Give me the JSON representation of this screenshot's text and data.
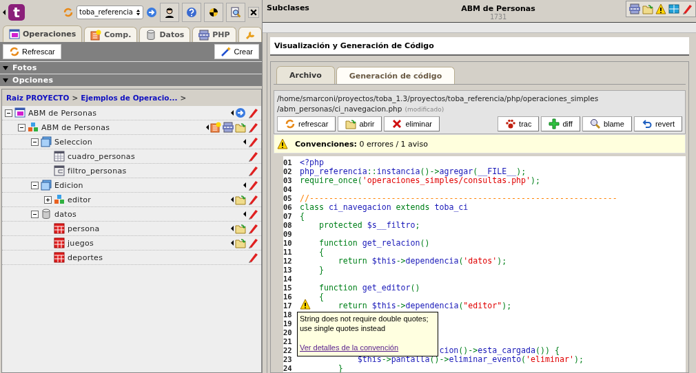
{
  "left": {
    "logo": "t",
    "project": "toba_referencia",
    "tabs": [
      {
        "label": "Operaciones",
        "kind": "op",
        "selected": true
      },
      {
        "label": "Comp.",
        "kind": "comp",
        "selected": false
      },
      {
        "label": "Datos",
        "kind": "db",
        "selected": false
      },
      {
        "label": "PHP",
        "kind": "php",
        "selected": false
      },
      {
        "kind": "wrench",
        "selected": false
      }
    ],
    "toolbar": {
      "refresh": "Refrescar",
      "create": "Crear"
    },
    "sections": [
      {
        "label": "Fotos",
        "expanded": true
      },
      {
        "label": "Opciones",
        "expanded": true
      }
    ],
    "breadcrumb": [
      {
        "label": "Raiz PROYECTO",
        "kind": "link"
      },
      {
        "label": ">",
        "kind": "sep"
      },
      {
        "label": "Ejemplos de Operacio...",
        "kind": "link"
      },
      {
        "label": ">",
        "kind": "sep"
      }
    ],
    "tree": [
      {
        "label": "ABM de Personas",
        "kind": "op",
        "expanded": true,
        "actions": [
          {
            "kind": "menu"
          },
          {
            "kind": "go"
          },
          {
            "kind": "edit"
          }
        ],
        "children": [
          {
            "label": "ABM de Personas",
            "kind": "ci",
            "expanded": true,
            "actions": [
              {
                "kind": "menu"
              },
              {
                "kind": "comp"
              },
              {
                "kind": "php"
              },
              {
                "kind": "folder"
              },
              {
                "kind": "edit"
              }
            ],
            "children": [
              {
                "label": "Seleccion",
                "kind": "screen",
                "expanded": true,
                "actions": [
                  {
                    "kind": "menu"
                  },
                  {
                    "kind": "edit"
                  }
                ],
                "children": [
                  {
                    "label": "cuadro_personas",
                    "kind": "grid",
                    "actions": [
                      {
                        "kind": "edit"
                      }
                    ]
                  },
                  {
                    "label": "filtro_personas",
                    "kind": "form",
                    "actions": [
                      {
                        "kind": "edit"
                      }
                    ]
                  }
                ]
              },
              {
                "label": "Edicion",
                "kind": "screen",
                "expanded": true,
                "actions": [
                  {
                    "kind": "menu"
                  },
                  {
                    "kind": "edit"
                  }
                ],
                "children": [
                  {
                    "label": "editor",
                    "kind": "ci",
                    "expanded": false,
                    "actions": [
                      {
                        "kind": "menu"
                      },
                      {
                        "kind": "folder"
                      },
                      {
                        "kind": "edit"
                      }
                    ]
                  }
                ]
              },
              {
                "label": "datos",
                "kind": "db",
                "expanded": true,
                "actions": [
                  {
                    "kind": "menu"
                  },
                  {
                    "kind": "edit"
                  }
                ],
                "children": [
                  {
                    "label": "persona",
                    "kind": "table",
                    "actions": [
                      {
                        "kind": "menu"
                      },
                      {
                        "kind": "folder"
                      },
                      {
                        "kind": "edit"
                      }
                    ]
                  },
                  {
                    "label": "juegos",
                    "kind": "table",
                    "actions": [
                      {
                        "kind": "menu"
                      },
                      {
                        "kind": "folder2"
                      },
                      {
                        "kind": "edit"
                      }
                    ]
                  },
                  {
                    "label": "deportes",
                    "kind": "table",
                    "actions": [
                      {
                        "kind": "edit"
                      }
                    ]
                  }
                ]
              }
            ]
          }
        ]
      }
    ]
  },
  "right": {
    "header": {
      "title": "Subclases",
      "item": "ABM de Personas",
      "id": "1731",
      "tools": [
        {
          "kind": "php"
        },
        {
          "kind": "folder"
        },
        {
          "kind": "warning"
        },
        {
          "kind": "cubes"
        },
        {
          "kind": "edit"
        }
      ]
    },
    "panel_title": "Visualización y Generación de Código",
    "tabs": [
      {
        "label": "Archivo",
        "selected": true
      },
      {
        "label": "Generación de código",
        "selected": false
      }
    ],
    "file": {
      "path_1": "/home/smarconi/proyectos/toba_1.3/proyectos/toba_referencia/php/operaciones_simples",
      "path_2": "/abm_personas/ci_navegacion.php",
      "status": "(modificado)"
    },
    "buttons_left": [
      {
        "label": "refrescar",
        "kind": "refresh"
      },
      {
        "label": "abrir",
        "kind": "open"
      },
      {
        "label": "eliminar",
        "kind": "delete"
      }
    ],
    "buttons_right": [
      {
        "label": "trac",
        "kind": "paw"
      },
      {
        "label": "diff",
        "kind": "diff"
      },
      {
        "label": "blame",
        "kind": "blame"
      },
      {
        "label": "revert",
        "kind": "revert"
      }
    ],
    "conventions": "**Convenciones:** 0 errores / 1 aviso",
    "code": [
      {
        "n": "01",
        "tokens": [
          {
            "kind": "k",
            "text": "<?php"
          }
        ]
      },
      {
        "n": "02",
        "tokens": [
          {
            "kind": "k",
            "text": "php_referencia"
          },
          {
            "kind": "g",
            "text": "::"
          },
          {
            "kind": "k",
            "text": "instancia"
          },
          {
            "kind": "g",
            "text": "()->"
          },
          {
            "kind": "k",
            "text": "agregar"
          },
          {
            "kind": "g",
            "text": "("
          },
          {
            "kind": "k",
            "text": "__FILE__"
          },
          {
            "kind": "g",
            "text": ");"
          }
        ]
      },
      {
        "n": "03",
        "tokens": [
          {
            "kind": "g",
            "text": "require_once("
          },
          {
            "kind": "s",
            "text": "'operaciones_simples/consultas.php'"
          },
          {
            "kind": "g",
            "text": ");"
          }
        ]
      },
      {
        "n": "04"
      },
      {
        "n": "05",
        "tokens": [
          {
            "kind": "c",
            "text": "//----------------------------------------------------------------"
          }
        ]
      },
      {
        "n": "06",
        "tokens": [
          {
            "kind": "g",
            "text": "class "
          },
          {
            "kind": "k",
            "text": "ci_navegacion"
          },
          {
            "kind": "g",
            "text": " extends "
          },
          {
            "kind": "k",
            "text": "toba_ci"
          }
        ]
      },
      {
        "n": "07",
        "tokens": [
          {
            "kind": "g",
            "text": "{"
          }
        ]
      },
      {
        "n": "08",
        "tokens": [
          {
            "kind": "g",
            "text": "    protected "
          },
          {
            "kind": "k",
            "text": "$s__filtro"
          },
          {
            "kind": "g",
            "text": ";"
          }
        ]
      },
      {
        "n": "09"
      },
      {
        "n": "10",
        "tokens": [
          {
            "kind": "g",
            "text": "    function "
          },
          {
            "kind": "k",
            "text": "get_relacion"
          },
          {
            "kind": "g",
            "text": "()"
          }
        ]
      },
      {
        "n": "11",
        "tokens": [
          {
            "kind": "g",
            "text": "    {"
          }
        ]
      },
      {
        "n": "12",
        "tokens": [
          {
            "kind": "g",
            "text": "        return "
          },
          {
            "kind": "k",
            "text": "$this"
          },
          {
            "kind": "g",
            "text": "->"
          },
          {
            "kind": "k",
            "text": "dependencia"
          },
          {
            "kind": "g",
            "text": "("
          },
          {
            "kind": "s",
            "text": "'datos'"
          },
          {
            "kind": "g",
            "text": ");"
          }
        ]
      },
      {
        "n": "13",
        "tokens": [
          {
            "kind": "g",
            "text": "    }"
          }
        ]
      },
      {
        "n": "14"
      },
      {
        "n": "15",
        "tokens": [
          {
            "kind": "g",
            "text": "    function "
          },
          {
            "kind": "k",
            "text": "get_editor"
          },
          {
            "kind": "g",
            "text": "()"
          }
        ]
      },
      {
        "n": "16",
        "tokens": [
          {
            "kind": "g",
            "text": "    {"
          }
        ]
      },
      {
        "n": "17",
        "warning": true,
        "tokens": [
          {
            "kind": "g",
            "text": "        return "
          },
          {
            "kind": "k",
            "text": "$this"
          },
          {
            "kind": "g",
            "text": "->"
          },
          {
            "kind": "k",
            "text": "dependencia"
          },
          {
            "kind": "g",
            "text": "("
          },
          {
            "kind": "s",
            "text": "\"editor\""
          },
          {
            "kind": "g",
            "text": ");"
          }
        ]
      },
      {
        "n": "18"
      },
      {
        "n": "19"
      },
      {
        "n": "20"
      },
      {
        "n": "21"
      },
      {
        "n": "22",
        "tokens": [
          {
            "kind": "k",
            "text": "                             cion"
          },
          {
            "kind": "g",
            "text": "()->"
          },
          {
            "kind": "k",
            "text": "esta_cargada"
          },
          {
            "kind": "g",
            "text": "()) {"
          }
        ]
      },
      {
        "n": "23",
        "tokens": [
          {
            "kind": "k",
            "text": "            $this"
          },
          {
            "kind": "g",
            "text": "->"
          },
          {
            "kind": "k",
            "text": "pantalla"
          },
          {
            "kind": "g",
            "text": "()->"
          },
          {
            "kind": "k",
            "text": "eliminar_evento"
          },
          {
            "kind": "g",
            "text": "("
          },
          {
            "kind": "s",
            "text": "'eliminar'"
          },
          {
            "kind": "g",
            "text": ");"
          }
        ]
      },
      {
        "n": "24",
        "tokens": [
          {
            "kind": "g",
            "text": "        }"
          }
        ]
      }
    ],
    "tooltip": {
      "line_1": "String does not require double quotes;",
      "line_2": "use single quotes instead",
      "link": "Ver detalles de la convención"
    }
  }
}
